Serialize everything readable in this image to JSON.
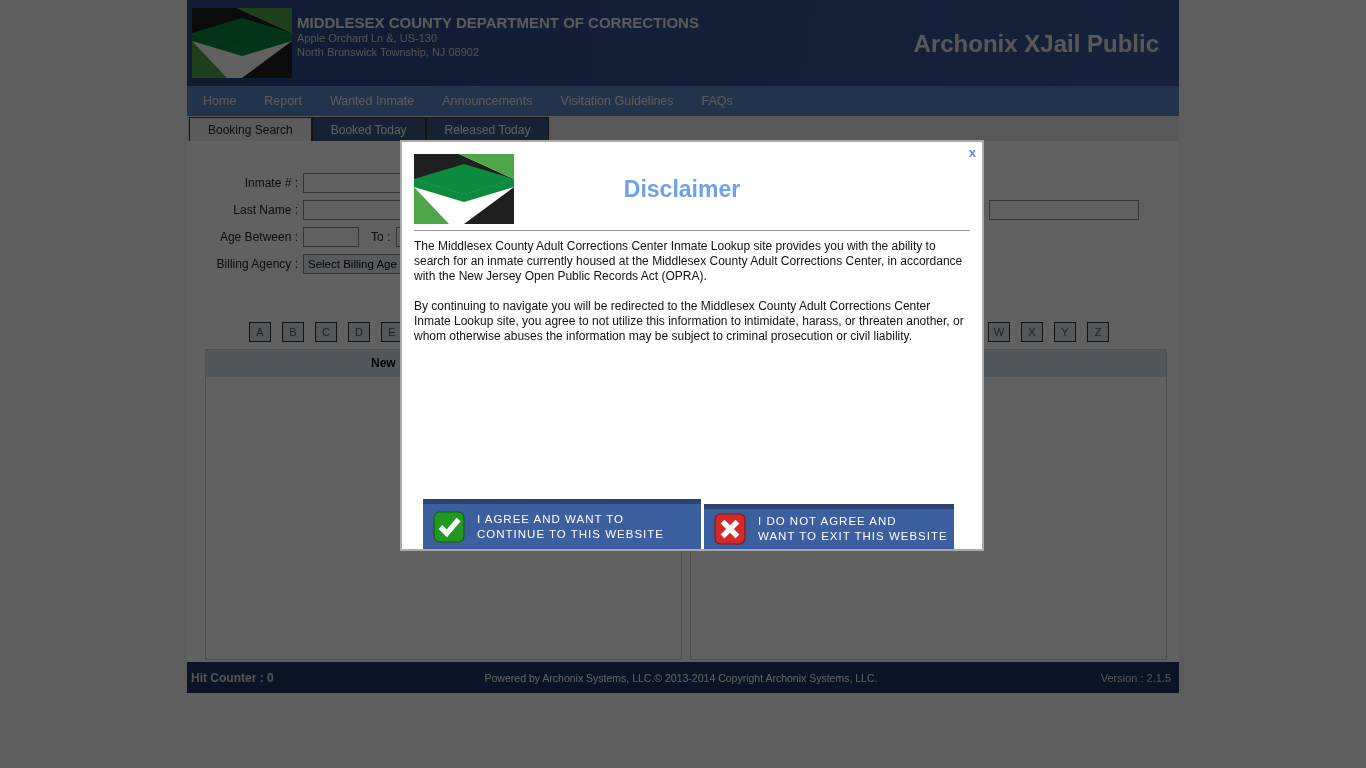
{
  "header": {
    "title": "MIDDLESEX COUNTY DEPARTMENT OF CORRECTIONS",
    "address_lines": [
      "Apple Orchard Ln &, US-130",
      "North Brunswick Township, NJ 08902"
    ],
    "product": "Archonix XJail Public"
  },
  "nav": {
    "items": [
      {
        "label": "Home"
      },
      {
        "label": "Report"
      },
      {
        "label": "Wanted Inmate"
      },
      {
        "label": "Announcements"
      },
      {
        "label": "Visitation Guidelines"
      },
      {
        "label": "FAQs"
      }
    ]
  },
  "tabs": [
    {
      "label": "Booking Search",
      "selected": true
    },
    {
      "label": "Booked Today",
      "selected": false
    },
    {
      "label": "Released Today",
      "selected": false
    }
  ],
  "search_form": {
    "inmate_label": "Inmate # :",
    "last_name_label": "Last Name :",
    "age_label": "Age Between :",
    "to_label": "To :",
    "billing_label": "Billing Agency :",
    "billing_value": "Select Billing Age"
  },
  "letters_left": [
    "A",
    "B",
    "C",
    "D",
    "E"
  ],
  "letters_right": [
    "W",
    "X",
    "Y",
    "Z"
  ],
  "results": {
    "header": "New"
  },
  "footer": {
    "hit_counter": "Hit Counter : 0",
    "powered": "Powered by Archonix Systems, LLC.© 2013-2014 Copyright Archonix Systems, LLC.",
    "version": "Version : 2.1.5"
  },
  "dialog": {
    "title": "Disclaimer",
    "close": "x",
    "paragraphs": [
      "The Middlesex County Adult Corrections Center Inmate Lookup site provides you with the ability to search for an inmate currently housed at the Middlesex County Adult Corrections Center, in accordance with the New Jersey Open Public Records Act (OPRA).",
      "By continuing to navigate you will be redirected to the Middlesex County Adult Corrections Center Inmate Lookup site, you agree to not utilize this information to intimidate, harass, or threaten another, or whom otherwise abuses the information may be subject to criminal prosecution or civil liability."
    ],
    "agree_button": {
      "lines": [
        "I AGREE AND WANT TO",
        "CONTINUE TO THIS WEBSITE"
      ]
    },
    "disagree_button": {
      "lines": [
        "I DO NOT AGREE AND",
        "WANT TO EXIT THIS WEBSITE"
      ]
    }
  }
}
